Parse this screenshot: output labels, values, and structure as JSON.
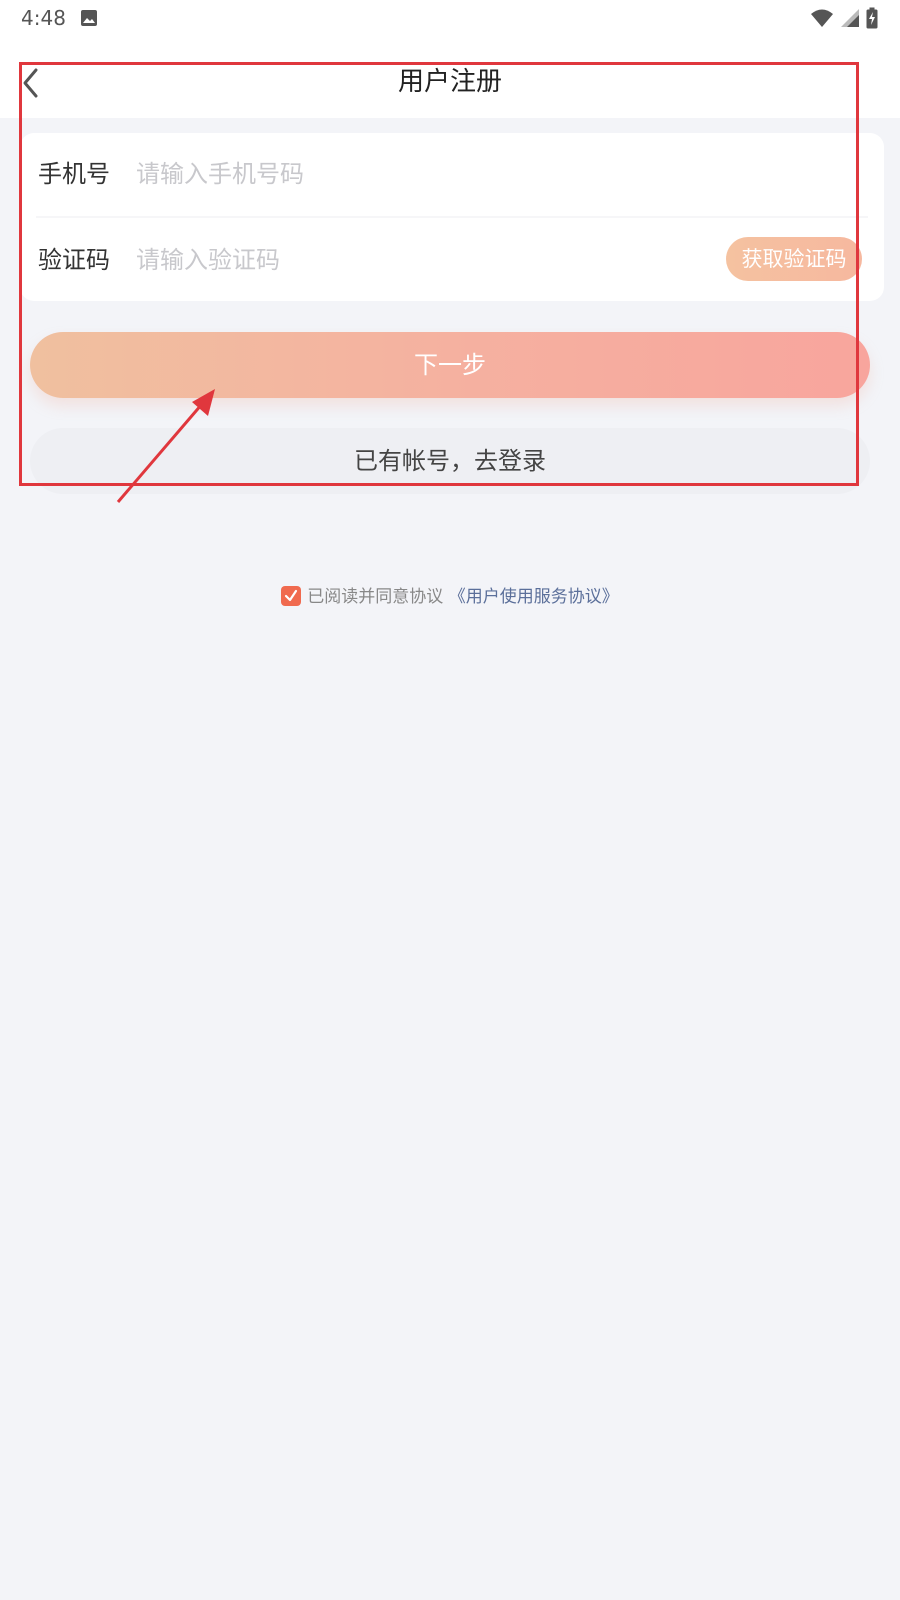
{
  "status_bar": {
    "time": "4:48"
  },
  "header": {
    "title": "用户注册"
  },
  "form": {
    "phone": {
      "label": "手机号",
      "placeholder": "请输入手机号码"
    },
    "code": {
      "label": "验证码",
      "placeholder": "请输入验证码",
      "get_code_label": "获取验证码"
    }
  },
  "actions": {
    "next_label": "下一步",
    "login_label": "已有帐号，去登录"
  },
  "agreement": {
    "text": "已阅读并同意协议",
    "link_text": "《用户使用服务协议》",
    "checked": true
  },
  "colors": {
    "accent": "#f5b1a0",
    "checkbox": "#f06a4f",
    "link": "#5b6f9a",
    "annotation": "#e0373d"
  },
  "icons": {
    "back": "chevron-left-icon",
    "photo": "image-icon",
    "wifi": "wifi-icon",
    "signal": "signal-icon",
    "battery": "battery-charging-icon"
  }
}
